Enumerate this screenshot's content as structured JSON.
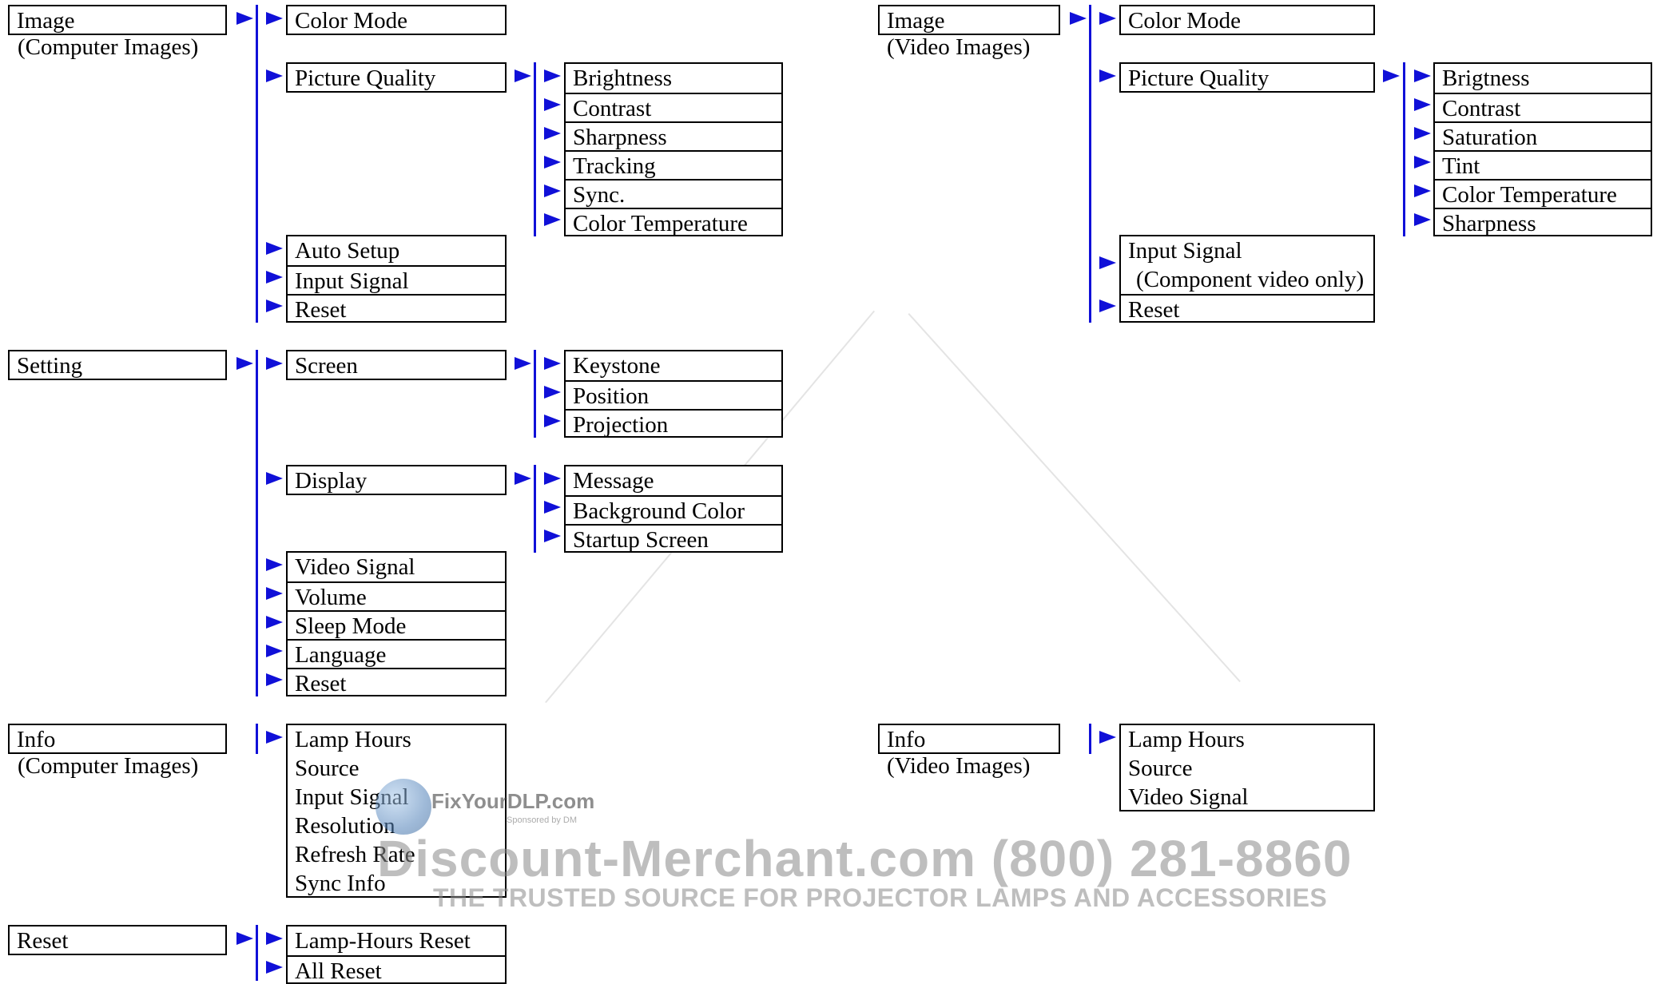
{
  "computer": {
    "image": {
      "label": "Image",
      "caption": "(Computer Images)",
      "items": [
        "Color Mode",
        "Picture Quality",
        "Auto Setup",
        "Input Signal",
        "Reset"
      ],
      "picture_quality_items": [
        "Brightness",
        "Contrast",
        "Sharpness",
        "Tracking",
        "Sync.",
        "Color Temperature"
      ]
    },
    "setting": {
      "label": "Setting",
      "items": [
        "Screen",
        "Display",
        "Video Signal",
        "Volume",
        "Sleep Mode",
        "Language",
        "Reset"
      ],
      "screen_items": [
        "Keystone",
        "Position",
        "Projection"
      ],
      "display_items": [
        "Message",
        "Background Color",
        "Startup Screen"
      ]
    },
    "info": {
      "label": "Info",
      "caption": "(Computer Images)",
      "items": [
        "Lamp Hours",
        "Source",
        "Input Signal",
        "Resolution",
        "Refresh Rate",
        "Sync Info"
      ]
    },
    "reset": {
      "label": "Reset",
      "items": [
        "Lamp-Hours Reset",
        "All Reset"
      ]
    }
  },
  "video": {
    "image": {
      "label": "Image",
      "caption": "(Video Images)",
      "items": [
        "Color Mode",
        "Picture Quality",
        "Input Signal",
        "Reset"
      ],
      "input_signal_note": "(Component video only)",
      "picture_quality_items": [
        "Brigtness",
        "Contrast",
        "Saturation",
        "Tint",
        "Color Temperature",
        "Sharpness"
      ]
    },
    "info": {
      "label": "Info",
      "caption": "(Video Images)",
      "items": [
        "Lamp Hours",
        "Source",
        "Video Signal"
      ]
    }
  },
  "watermark": {
    "site": "FixYourDLP.com",
    "sponsor": "Sponsored by DM",
    "company": "Discount-Merchant.com (800) 281-8860",
    "tagline": "THE TRUSTED SOURCE FOR PROJECTOR LAMPS AND ACCESSORIES"
  },
  "colors": {
    "arrow": "#1010d8",
    "border": "#000000",
    "watermark": "#8a8a8a"
  },
  "icons": {
    "arrow": "right-triangle-arrow-icon"
  }
}
